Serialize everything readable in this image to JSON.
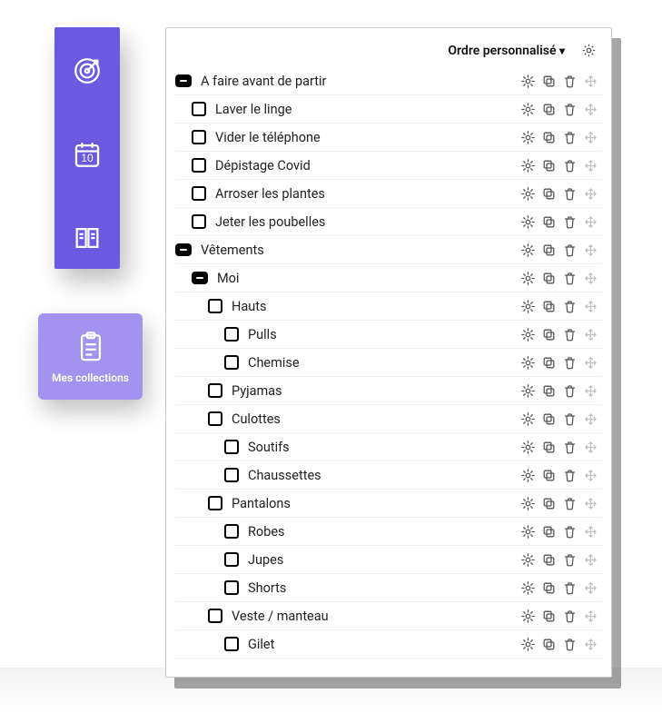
{
  "sidebar": {
    "items": [
      {
        "name": "target-icon"
      },
      {
        "name": "calendar-icon",
        "badge": "10"
      },
      {
        "name": "book-icon"
      }
    ],
    "active_tab": {
      "icon": "clipboard-icon",
      "label": "Mes collections"
    }
  },
  "panel": {
    "sort_label": "Ordre personnalisé"
  },
  "tree": [
    {
      "depth": 0,
      "kind": "group",
      "label": "A faire avant de partir"
    },
    {
      "depth": 1,
      "kind": "item",
      "label": "Laver le linge"
    },
    {
      "depth": 1,
      "kind": "item",
      "label": "Vider le téléphone"
    },
    {
      "depth": 1,
      "kind": "item",
      "label": "Dépistage Covid"
    },
    {
      "depth": 1,
      "kind": "item",
      "label": "Arroser les plantes"
    },
    {
      "depth": 1,
      "kind": "item",
      "label": "Jeter les poubelles"
    },
    {
      "depth": 0,
      "kind": "group",
      "label": "Vêtements"
    },
    {
      "depth": 1,
      "kind": "group",
      "label": "Moi"
    },
    {
      "depth": 2,
      "kind": "item",
      "label": "Hauts"
    },
    {
      "depth": 3,
      "kind": "item",
      "label": "Pulls"
    },
    {
      "depth": 3,
      "kind": "item",
      "label": "Chemise"
    },
    {
      "depth": 2,
      "kind": "item",
      "label": "Pyjamas"
    },
    {
      "depth": 2,
      "kind": "item",
      "label": "Culottes"
    },
    {
      "depth": 3,
      "kind": "item",
      "label": "Soutifs"
    },
    {
      "depth": 3,
      "kind": "item",
      "label": "Chaussettes"
    },
    {
      "depth": 2,
      "kind": "item",
      "label": "Pantalons"
    },
    {
      "depth": 3,
      "kind": "item",
      "label": "Robes"
    },
    {
      "depth": 3,
      "kind": "item",
      "label": "Jupes"
    },
    {
      "depth": 3,
      "kind": "item",
      "label": "Shorts"
    },
    {
      "depth": 2,
      "kind": "item",
      "label": "Veste / manteau"
    },
    {
      "depth": 3,
      "kind": "item",
      "label": "Gilet"
    }
  ]
}
